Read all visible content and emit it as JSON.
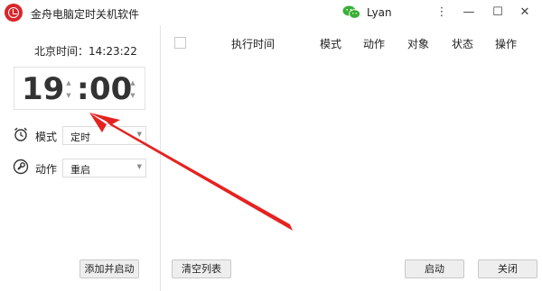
{
  "titlebar": {
    "app_title": "金舟电脑定时关机软件",
    "username": "Lyan",
    "menu_glyph": "⋮",
    "min_glyph": "—",
    "max_glyph": "☐",
    "close_glyph": "✕"
  },
  "left": {
    "beijing_time_label": "北京时间：14:23:22",
    "hour": "19",
    "colon": ":",
    "minute": "00",
    "spin_up": "▲",
    "spin_down": "▼",
    "mode_label": "模式",
    "mode_value": "定时",
    "action_label": "动作",
    "action_value": "重启",
    "dropdown_arrow": "▼",
    "add_start_button": "添加并启动"
  },
  "table": {
    "columns": [
      "执行时间",
      "模式",
      "动作",
      "对象",
      "状态",
      "操作"
    ],
    "rows": []
  },
  "footer": {
    "clear_list_button": "清空列表",
    "start_button": "启动",
    "close_button": "关闭"
  },
  "colors": {
    "brand_red": "#d9262b",
    "wechat_green": "#39b035",
    "annotation_arrow": "#e42320"
  },
  "icons": [
    "app-logo-icon",
    "wechat-icon",
    "menu-icon",
    "minimize-icon",
    "maximize-icon",
    "close-icon",
    "alarm-clock-icon",
    "wrench-icon",
    "annotation-arrow"
  ]
}
